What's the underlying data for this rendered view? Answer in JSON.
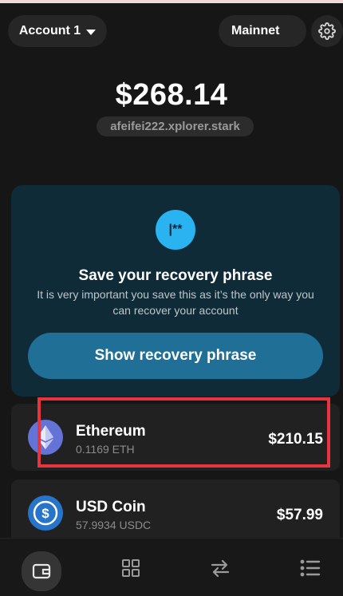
{
  "header": {
    "account_label": "Account 1",
    "network_label": "Mainnet"
  },
  "balance": {
    "total": "$268.14",
    "domain": "afeifei222.xplorer.stark"
  },
  "recovery": {
    "icon_text": "|**",
    "title": "Save your recovery phrase",
    "description": "It is very important you save this as it’s the only way you can recover your account",
    "button_label": "Show recovery phrase"
  },
  "tokens": [
    {
      "name": "Ethereum",
      "amount": "0.1169 ETH",
      "value": "$210.15",
      "icon": "ethereum-icon",
      "color": "#6473d6"
    },
    {
      "name": "USD Coin",
      "amount": "57.9934 USDC",
      "value": "$57.99",
      "icon": "usdc-icon",
      "color": "#2775ca"
    }
  ],
  "nav": {
    "items": [
      {
        "icon": "wallet-icon",
        "active": true
      },
      {
        "icon": "grid-icon",
        "active": false
      },
      {
        "icon": "swap-arrows-icon",
        "active": false
      },
      {
        "icon": "list-icon",
        "active": false
      }
    ]
  },
  "colors": {
    "background": "#161616",
    "card": "#212121",
    "recovery_card": "#0f2b38",
    "accent": "#29b3f0",
    "button": "#1f6f97",
    "highlight": "#e8343f"
  }
}
